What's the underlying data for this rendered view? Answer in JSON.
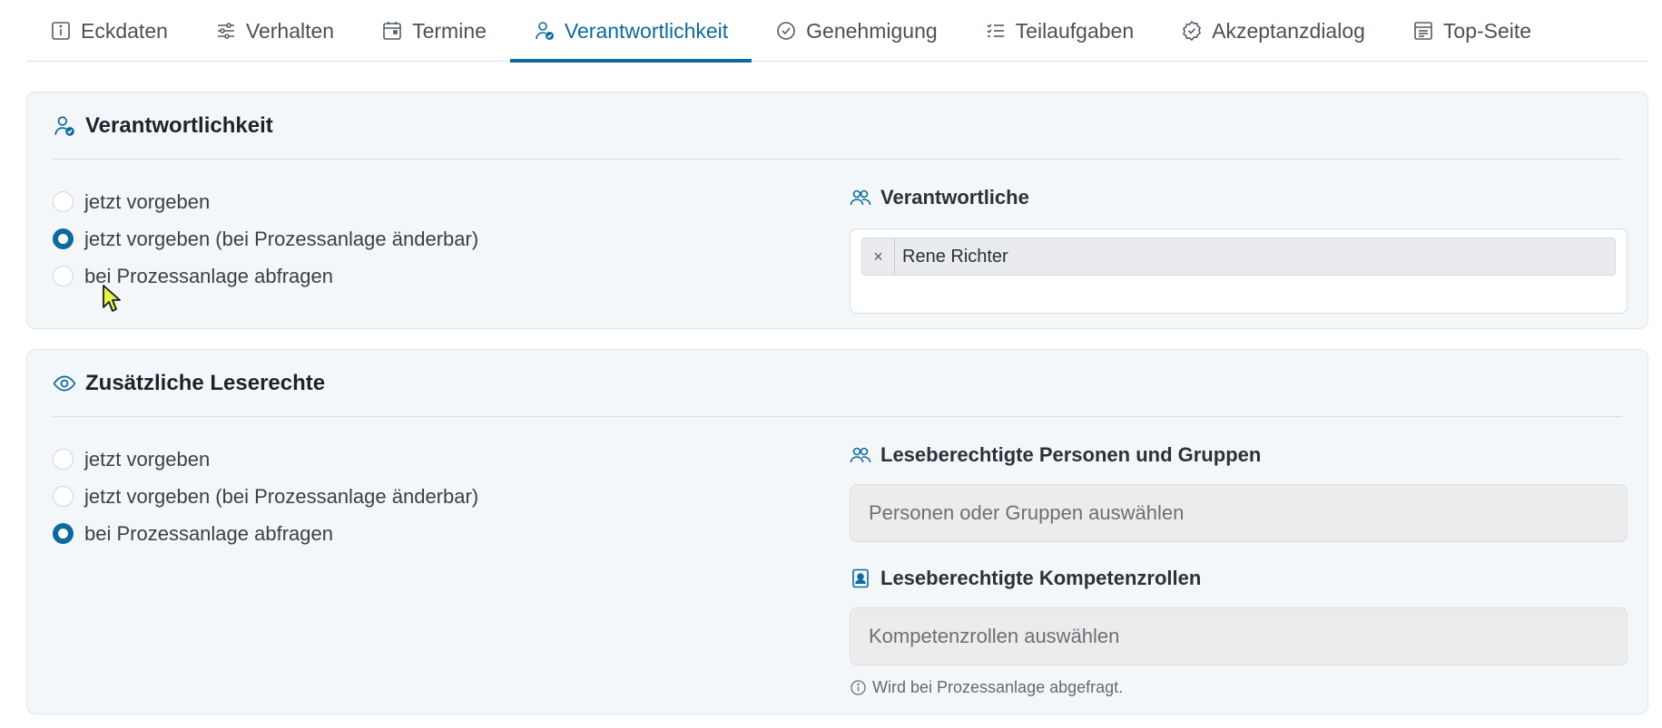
{
  "tabs": [
    {
      "label": "Eckdaten",
      "icon": "info-box-icon",
      "active": false
    },
    {
      "label": "Verhalten",
      "icon": "sliders-icon",
      "active": false
    },
    {
      "label": "Termine",
      "icon": "calendar-icon",
      "active": false
    },
    {
      "label": "Verantwortlichkeit",
      "icon": "user-check-icon",
      "active": true
    },
    {
      "label": "Genehmigung",
      "icon": "check-circle-icon",
      "active": false
    },
    {
      "label": "Teilaufgaben",
      "icon": "checklist-icon",
      "active": false
    },
    {
      "label": "Akzeptanzdialog",
      "icon": "badge-check-icon",
      "active": false
    },
    {
      "label": "Top-Seite",
      "icon": "page-icon",
      "active": false
    }
  ],
  "responsibility": {
    "title": "Verantwortlichkeit",
    "options": [
      {
        "label": "jetzt vorgeben",
        "checked": false
      },
      {
        "label": "jetzt vorgeben (bei Prozessanlage änderbar)",
        "checked": true
      },
      {
        "label": "bei Prozessanlage abfragen",
        "checked": false
      }
    ],
    "field_label": "Verantwortliche",
    "tags": [
      {
        "label": "Rene Richter",
        "remove": "×"
      }
    ]
  },
  "read_rights": {
    "title": "Zusätzliche Leserechte",
    "options": [
      {
        "label": "jetzt vorgeben",
        "checked": false
      },
      {
        "label": "jetzt vorgeben (bei Prozessanlage änderbar)",
        "checked": false
      },
      {
        "label": "bei Prozessanlage abfragen",
        "checked": true
      }
    ],
    "persons_label": "Leseberechtigte Personen und Gruppen",
    "persons_placeholder": "Personen oder Gruppen auswählen",
    "roles_label": "Leseberechtigte Kompetenzrollen",
    "roles_placeholder": "Kompetenzrollen auswählen",
    "hint": "Wird bei Prozessanlage abgefragt."
  },
  "colors": {
    "accent": "#0c6a9c",
    "panel_bg": "#f4f7fa",
    "field_disabled_bg": "#ececec"
  }
}
